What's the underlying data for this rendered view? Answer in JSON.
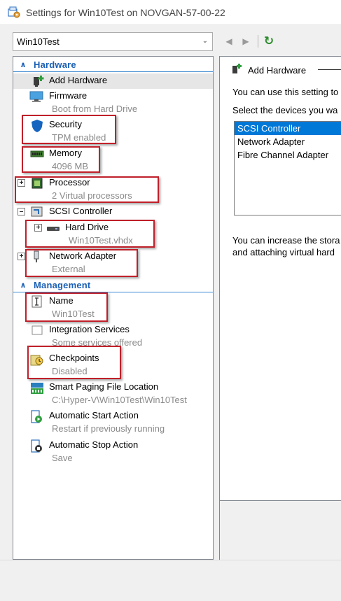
{
  "window": {
    "title": "Settings for Win10Test on NOVGAN-57-00-22"
  },
  "vm_selector": {
    "value": "Win10Test"
  },
  "sections": {
    "hardware": {
      "label": "Hardware"
    },
    "management": {
      "label": "Management"
    }
  },
  "hardware_items": {
    "add_hardware": {
      "name": "Add Hardware"
    },
    "firmware": {
      "name": "Firmware",
      "sub": "Boot from Hard Drive"
    },
    "security": {
      "name": "Security",
      "sub": "TPM enabled"
    },
    "memory": {
      "name": "Memory",
      "sub": "4096 MB"
    },
    "processor": {
      "name": "Processor",
      "sub": "2 Virtual processors"
    },
    "scsi": {
      "name": "SCSI Controller"
    },
    "hard_drive": {
      "name": "Hard Drive",
      "sub": "Win10Test.vhdx"
    },
    "network": {
      "name": "Network Adapter",
      "sub": "External"
    }
  },
  "management_items": {
    "name": {
      "name": "Name",
      "sub": "Win10Test"
    },
    "integration": {
      "name": "Integration Services",
      "sub": "Some services offered"
    },
    "checkpoints": {
      "name": "Checkpoints",
      "sub": "Disabled"
    },
    "smart_paging": {
      "name": "Smart Paging File Location",
      "sub": "C:\\Hyper-V\\Win10Test\\Win10Test"
    },
    "auto_start": {
      "name": "Automatic Start Action",
      "sub": "Restart if previously running"
    },
    "auto_stop": {
      "name": "Automatic Stop Action",
      "sub": "Save"
    }
  },
  "right_panel": {
    "group_title": "Add Hardware",
    "intro": "You can use this setting to",
    "select_prompt": "Select the devices you wa",
    "devices": [
      "SCSI Controller",
      "Network Adapter",
      "Fibre Channel Adapter"
    ],
    "storage_line1": "You can increase the stora",
    "storage_line2": "and attaching virtual hard"
  },
  "colors": {
    "accent": "#1a5fb4",
    "highlight_box": "#c0202a",
    "selection": "#0078d7"
  }
}
